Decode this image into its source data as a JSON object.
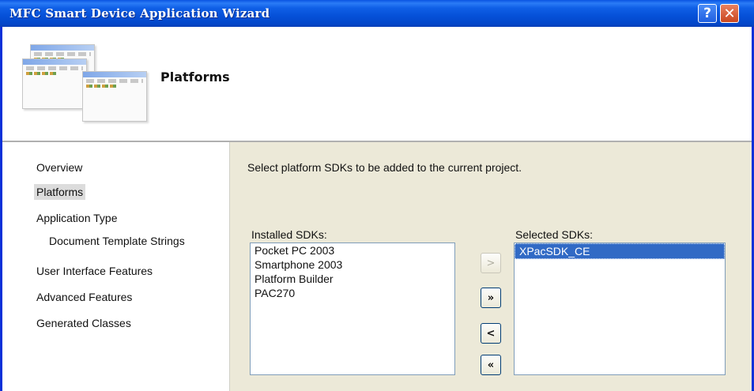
{
  "window": {
    "title": "MFC Smart Device Application Wizard",
    "help_glyph": "?",
    "close_glyph": "✕"
  },
  "header": {
    "title": "Platforms",
    "graphic_icon": "wizard-windows-graphic"
  },
  "sidebar": {
    "items": [
      {
        "label": "Overview"
      },
      {
        "label": "Platforms"
      },
      {
        "label": "Application Type"
      },
      {
        "label": "Document Template Strings"
      },
      {
        "label": "User Interface Features"
      },
      {
        "label": "Advanced Features"
      },
      {
        "label": "Generated Classes"
      }
    ]
  },
  "main": {
    "instruction": "Select platform SDKs to be added to the current project.",
    "installed": {
      "label": "Installed SDKs:",
      "items": [
        "Pocket PC 2003",
        "Smartphone 2003",
        "Platform Builder",
        "PAC270"
      ]
    },
    "selected": {
      "label": "Selected SDKs:",
      "items": [
        "XPacSDK_CE"
      ]
    },
    "buttons": {
      "add": ">",
      "add_all": "»",
      "remove": "<",
      "remove_all": "«"
    }
  },
  "colors": {
    "titlebar": "#0a54e2",
    "selection": "#316ac5",
    "panel": "#ece9d8"
  }
}
